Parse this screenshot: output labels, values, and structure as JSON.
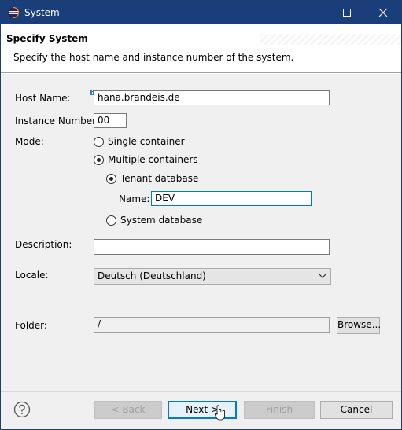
{
  "window": {
    "title": "System"
  },
  "header": {
    "title": "Specify System",
    "description": "Specify the host name and instance number of the system."
  },
  "form": {
    "host_name_label": "Host Name:",
    "host_name_value": "hana.brandeis.de",
    "instance_number_label": "Instance Number:",
    "instance_number_value": "00",
    "mode_label": "Mode:",
    "mode_single": "Single container",
    "mode_multiple": "Multiple containers",
    "mode_selected": "Multiple containers",
    "tenant_database": "Tenant database",
    "tenant_selected": "Tenant database",
    "name_label": "Name:",
    "name_value": "DEV",
    "system_database": "System database",
    "description_label": "Description:",
    "description_value": "",
    "locale_label": "Locale:",
    "locale_value": "Deutsch (Deutschland)",
    "folder_label": "Folder:",
    "folder_value": "/",
    "browse_label": "Browse..."
  },
  "footer": {
    "back": "< Back",
    "next": "Next >",
    "finish": "Finish",
    "cancel": "Cancel"
  },
  "colors": {
    "titlebar": "#1a3e7a",
    "focus": "#0078d7",
    "header_bg": "#ffffff",
    "dialog_bg": "#f0f0f0"
  }
}
